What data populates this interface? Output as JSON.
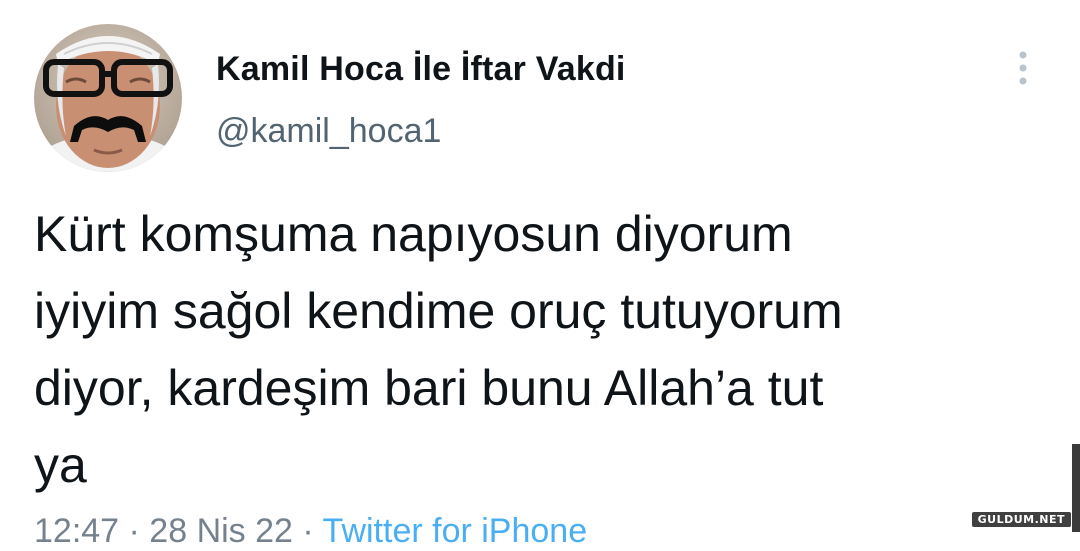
{
  "tweet": {
    "display_name": "Kamil Hoca İle İftar Vakdi",
    "handle": "@kamil_hoca1",
    "text": "Kürt komşuma napıyosun diyorum\niyiyim sağol kendime oruç tutuyorum\ndiyor, kardeşim bari bunu Allah’a tut\nya",
    "meta_time": "12:47 · 28 Nis 22 · ",
    "meta_source": "Twitter for iPhone",
    "avatar_icon": "profile-photo",
    "more_icon": "more-vertical-icon"
  },
  "watermark": "GULDUM.NET",
  "colors": {
    "text": "#0f1419",
    "secondary": "#536471",
    "link": "#1d9bf0"
  }
}
